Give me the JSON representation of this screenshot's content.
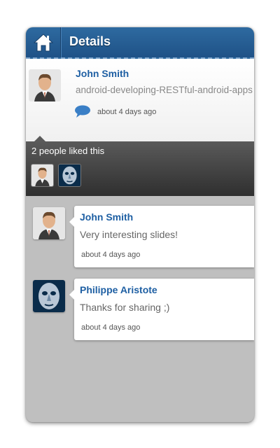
{
  "header": {
    "title": "Details"
  },
  "post": {
    "author": "John Smith",
    "text": "android-developing-RESTful-android-apps",
    "time": "about 4 days ago"
  },
  "likes": {
    "summary": "2 people liked this",
    "users": [
      "John Smith",
      "Philippe Aristote"
    ]
  },
  "comments": [
    {
      "author": "John Smith",
      "text": "Very interesting slides!",
      "time": "about 4 days ago"
    },
    {
      "author": "Philippe Aristote",
      "text": "Thanks for sharing ;)",
      "time": "about 4 days ago"
    }
  ],
  "colors": {
    "accent": "#1e5fa3",
    "topbar": "#2565a0",
    "dark_band": "#3d3d3d",
    "background": "#bfbfbf"
  }
}
